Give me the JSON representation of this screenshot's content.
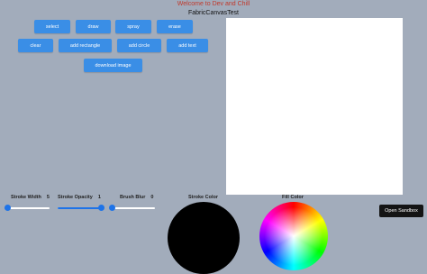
{
  "header": {
    "welcome": "Welcome to Dev and Chill",
    "title": "FabricCanvasTest"
  },
  "toolbar": {
    "select": "select",
    "draw": "draw",
    "spray": "spray",
    "erase": "erase",
    "clear": "clear",
    "add_rectangle": "add rectangle",
    "add_circle": "add circle",
    "add_text": "add text",
    "download": "download image"
  },
  "controls": {
    "stroke_width": {
      "label": "Stroke Width",
      "value": "5",
      "level": 0.05
    },
    "stroke_opacity": {
      "label": "Stroke Opacity",
      "value": "1",
      "level": 1.0
    },
    "brush_blur": {
      "label": "Brush Blur",
      "value": "0",
      "level": 0.0
    }
  },
  "colors": {
    "stroke_label": "Stroke Color",
    "fill_label": "Fill Color",
    "stroke_value": "#000000",
    "accent": "#3a8ee6"
  },
  "sandbox": {
    "label": "Open Sandbox"
  }
}
